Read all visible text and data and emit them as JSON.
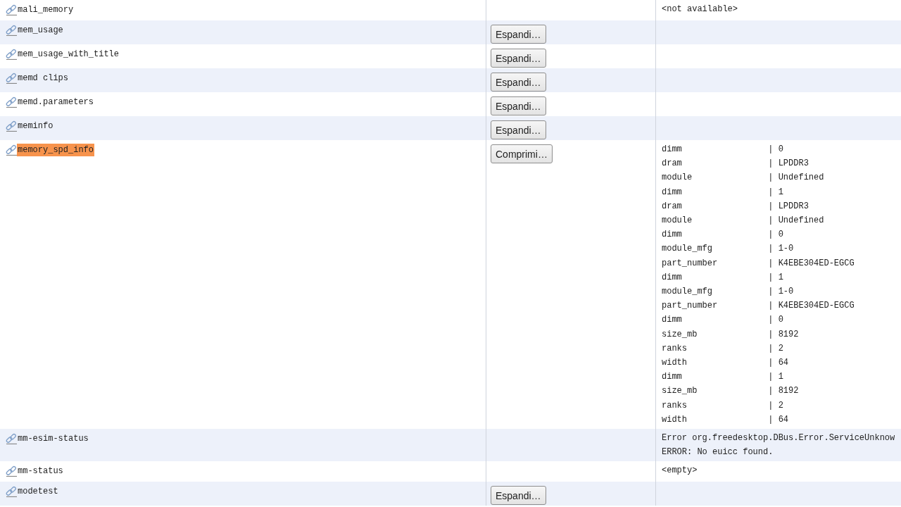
{
  "rows": [
    {
      "name": "mali_memory",
      "highlighted": false,
      "output": [
        "<not available>"
      ]
    },
    {
      "name": "mem_usage",
      "highlighted": false,
      "button": {
        "label": "Espandi…"
      }
    },
    {
      "name": "mem_usage_with_title",
      "highlighted": false,
      "button": {
        "label": "Espandi…"
      }
    },
    {
      "name": "memd clips",
      "highlighted": false,
      "button": {
        "label": "Espandi…"
      }
    },
    {
      "name": "memd.parameters",
      "highlighted": false,
      "button": {
        "label": "Espandi…"
      }
    },
    {
      "name": "meminfo",
      "highlighted": false,
      "button": {
        "label": "Espandi…"
      }
    },
    {
      "name": "memory_spd_info",
      "highlighted": true,
      "button": {
        "label": "Comprimi…"
      },
      "output": [
        "dimm                 | 0",
        "dram                 | LPDDR3",
        "module               | Undefined",
        "dimm                 | 1",
        "dram                 | LPDDR3",
        "module               | Undefined",
        "dimm                 | 0",
        "module_mfg           | 1-0",
        "part_number          | K4EBE304ED-EGCG",
        "dimm                 | 1",
        "module_mfg           | 1-0",
        "part_number          | K4EBE304ED-EGCG",
        "dimm                 | 0",
        "size_mb              | 8192",
        "ranks                | 2",
        "width                | 64",
        "dimm                 | 1",
        "size_mb              | 8192",
        "ranks                | 2",
        "width                | 64"
      ]
    },
    {
      "name": "mm-esim-status",
      "highlighted": false,
      "output": [
        "Error org.freedesktop.DBus.Error.ServiceUnknow",
        "ERROR: No euicc found."
      ]
    },
    {
      "name": "mm-status",
      "highlighted": false,
      "output": [
        "<empty>"
      ]
    },
    {
      "name": "modetest",
      "highlighted": false,
      "button": {
        "label": "Espandi…"
      }
    }
  ]
}
